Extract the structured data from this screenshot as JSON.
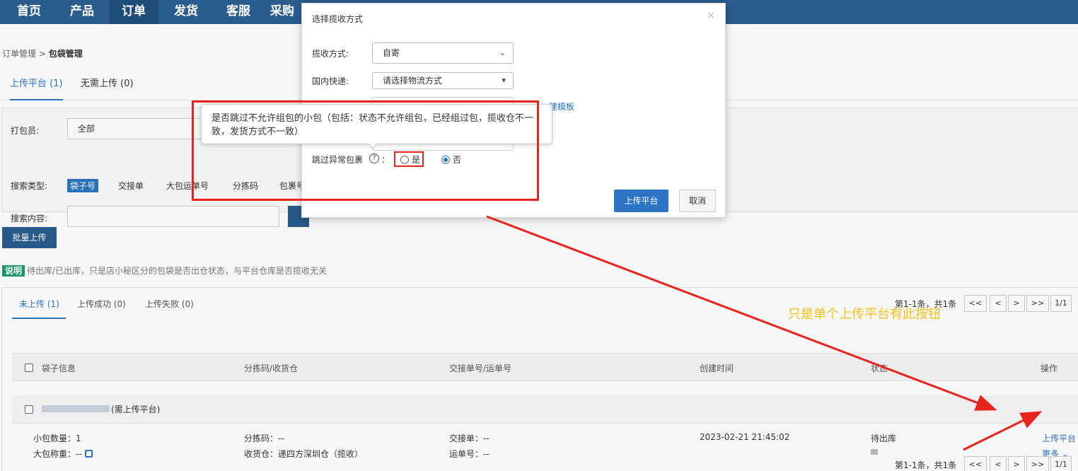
{
  "nav": {
    "items": [
      {
        "label": "首页",
        "active": false
      },
      {
        "label": "产品",
        "active": false
      },
      {
        "label": "订单",
        "active": true
      },
      {
        "label": "发货",
        "active": false
      },
      {
        "label": "客服",
        "active": false
      },
      {
        "label": "采购",
        "active": false
      }
    ]
  },
  "breadcrumb": {
    "parent": "订单管理",
    "separator": " > ",
    "current": "包袋管理"
  },
  "main_tabs": [
    {
      "label": "上传平台 (1)",
      "active": true
    },
    {
      "label": "无需上传 (0)",
      "active": false
    }
  ],
  "filters": {
    "packer_label": "打包员:",
    "packer_value": "全部",
    "search_type_label": "搜索类型:",
    "search_types": [
      {
        "label": "袋子号",
        "active": true
      },
      {
        "label": "交接单",
        "active": false
      },
      {
        "label": "大包运单号",
        "active": false
      },
      {
        "label": "分拣码",
        "active": false
      },
      {
        "label": "包裹号",
        "active": false
      }
    ],
    "search_content_label": "搜索内容:",
    "search_content_value": ""
  },
  "batch_upload_label": "批量上传",
  "note": {
    "tag": "说明",
    "text": "待出库/已出库，只是店小秘区分的包袋是否出仓状态，与平台仓库是否揽收无关"
  },
  "sub_tabs": [
    {
      "label": "未上传 (1)",
      "active": true
    },
    {
      "label": "上传成功 (0)",
      "active": false
    },
    {
      "label": "上传失败 (0)",
      "active": false
    }
  ],
  "pager": {
    "info": "第1-1条，共1条",
    "buttons": [
      "<<",
      "<",
      ">",
      ">>",
      "1/1"
    ]
  },
  "table": {
    "columns": [
      "袋子信息",
      "分拣码/收货仓",
      "交接单号/运单号",
      "创建时间",
      "状态",
      "操作"
    ],
    "group_label": "(需上传平台)",
    "row": {
      "small_pkg_count": "小包数量：1",
      "big_pkg_weight": "大包称重：--",
      "sort_code": "分拣码：--",
      "warehouse": "收货仓：递四方深圳仓（揽收）",
      "handover_no": "交接单：--",
      "waybill_no": "运单号：--",
      "created_at": "2023-02-21 21:45:02",
      "status": "待出库",
      "op_upload": "上传平台",
      "op_more": "更多"
    }
  },
  "modal": {
    "title": "选择揽收方式",
    "close": "×",
    "pickup_label": "揽收方式:",
    "pickup_value": "自寄",
    "courier_label": "国内快递:",
    "courier_placeholder": "请选择物流方式",
    "template_link": "建模板",
    "skip_label": "跳过异常包裹",
    "colon": "：",
    "help_glyph": "?",
    "option_yes": "是",
    "option_no": "否",
    "selected": "否",
    "submit": "上传平台",
    "cancel": "取消"
  },
  "tooltip": {
    "text": "是否跳过不允许组包的小包（包括：状态不允许组包，已经组过包，揽收仓不一致，发货方式不一致）"
  },
  "annotation": {
    "text": "只是单个上传平台有此按钮",
    "color": "#e8241d",
    "text_color": "#f4c21a"
  },
  "colors": {
    "nav_bg": "#2a5c8e",
    "accent": "#2d74c4",
    "note_tag": "#1a9c6d"
  }
}
